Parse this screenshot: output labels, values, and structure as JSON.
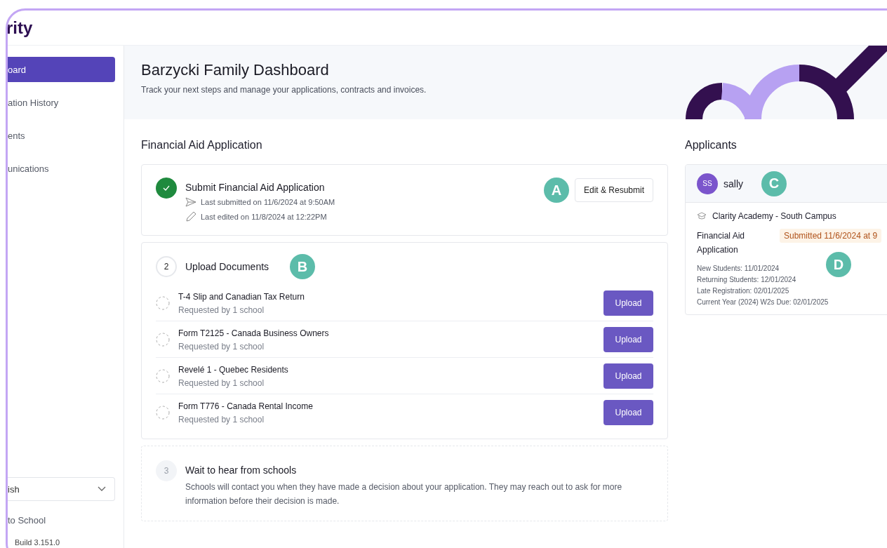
{
  "brand": {
    "logo_text": "rity"
  },
  "sidebar": {
    "items": [
      {
        "label": "oard",
        "selected": true
      },
      {
        "label": "ation History",
        "selected": false
      },
      {
        "label": "ents",
        "selected": false
      },
      {
        "label": "unications",
        "selected": false
      }
    ],
    "language_select": {
      "value": "ish"
    },
    "back_link": "to School",
    "build": "Build 3.151.0"
  },
  "banner": {
    "title": "Barzycki Family Dashboard",
    "subtitle": "Track your next steps and manage your applications, contracts and invoices."
  },
  "financial_aid": {
    "heading": "Financial Aid Application",
    "steps": [
      {
        "kind": "done",
        "title": "Submit Financial Aid Application",
        "marker": "A",
        "action": "Edit & Resubmit",
        "meta": [
          {
            "kind": "sent",
            "text": "Last submitted on 11/6/2024 at 9:50AM"
          },
          {
            "kind": "edited",
            "text": "Last edited on 11/8/2024 at 12:22PM"
          }
        ]
      },
      {
        "kind": "active",
        "number": "2",
        "title": "Upload Documents",
        "marker": "B",
        "documents": [
          {
            "name": "T-4 Slip and Canadian Tax Return",
            "note": "Requested by 1 school",
            "action": "Upload",
            "uploaded": false
          },
          {
            "name": "Form T2125 - Canada Business Owners",
            "note": "Requested by 1 school",
            "action": "Upload",
            "uploaded": false
          },
          {
            "name": "Revelé 1 - Quebec Residents",
            "note": "Requested by 1 school",
            "action": "Upload",
            "uploaded": false
          },
          {
            "name": "Form T776 - Canada Rental Income",
            "note": "Requested by 1 school",
            "action": "Upload",
            "uploaded": false
          }
        ]
      },
      {
        "kind": "pending",
        "number": "3",
        "title": "Wait to hear from schools",
        "description": "Schools will contact you when they have made a decision about your application. They may reach out to ask for more information before their decision is made."
      }
    ]
  },
  "applicants": {
    "heading": "Applicants",
    "cards": [
      {
        "initials": "SS",
        "name": "sally",
        "marker": "C",
        "school": "Clarity Academy - South Campus",
        "form": "Financial Aid Application",
        "status": "Submitted 11/6/2024 at 9",
        "status_marker": "D",
        "deadlines": [
          "New Students: 11/01/2024",
          "Returning Students: 12/01/2024",
          "Late Registration: 02/01/2025",
          "Current Year (2024) W2s Due: 02/01/2025"
        ]
      }
    ]
  }
}
